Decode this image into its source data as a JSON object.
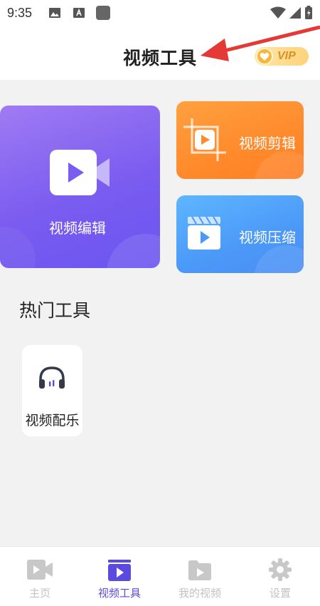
{
  "status_bar": {
    "time": "9:35"
  },
  "header": {
    "title": "视频工具",
    "vip_label": "VIP"
  },
  "colors": {
    "accent": "#5b4ae0",
    "annotation": "#e53935",
    "edit_card": "#7a5cf0",
    "cut_card": "#ff8a2b",
    "compress_card": "#4b99f8",
    "inactive_nav": "#c2c2c2"
  },
  "tools": {
    "edit": {
      "label": "视频编辑",
      "icon": "video-camera-icon"
    },
    "cut": {
      "label": "视频剪辑",
      "icon": "crop-play-icon"
    },
    "compress": {
      "label": "视频压缩",
      "icon": "clapperboard-icon"
    }
  },
  "hot_tools": {
    "title": "热门工具",
    "items": [
      {
        "label": "视频配乐",
        "icon": "headphones-icon"
      }
    ]
  },
  "bottom_nav": {
    "items": [
      {
        "label": "主页",
        "icon": "video-camera-icon",
        "active": false
      },
      {
        "label": "视频工具",
        "icon": "video-tool-icon",
        "active": true
      },
      {
        "label": "我的视频",
        "icon": "folder-video-icon",
        "active": false
      },
      {
        "label": "设置",
        "icon": "gear-icon",
        "active": false
      }
    ]
  }
}
